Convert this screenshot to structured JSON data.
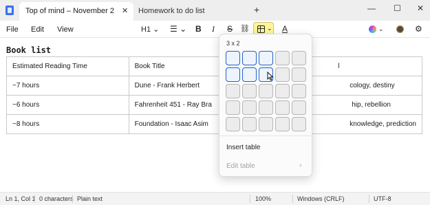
{
  "tabs": {
    "active_title": "Top of mind – November 2",
    "close_glyph": "✕",
    "second_title": "Homework to do list",
    "new_tab_glyph": "+"
  },
  "window": {
    "minimize": "—",
    "maximize": "☐",
    "close": "✕"
  },
  "menu": {
    "file": "File",
    "edit": "Edit",
    "view": "View"
  },
  "toolbar": {
    "heading": "H1 ⌄",
    "list": "☰ ⌄",
    "bold": "B",
    "italic": "I",
    "strike": "S",
    "link": "⛓",
    "table_chevron": "⌄",
    "spellcheck": "A",
    "copilot_chevron": "⌄",
    "settings": "⚙"
  },
  "document": {
    "title": "Book list",
    "table": {
      "headers": [
        "Estimated Reading Time",
        "Book Title",
        "l"
      ],
      "rows": [
        [
          "~7 hours",
          "Dune - Frank Herbert",
          "cology, destiny"
        ],
        [
          "~6 hours",
          "Fahrenheit 451 - Ray Bra",
          "hip, rebellion"
        ],
        [
          "~8 hours",
          "Foundation - Isaac Asim",
          "knowledge, prediction"
        ]
      ]
    }
  },
  "table_popup": {
    "size_label": "3 x 2",
    "grid": {
      "cols": 5,
      "rows": 5,
      "selected_cols": 3,
      "selected_rows": 2
    },
    "insert_label": "Insert table",
    "edit_label": "Edit table",
    "edit_arrow": "›"
  },
  "status": {
    "position": "Ln 1, Col 1",
    "characters": "0 characters",
    "format": "Plain text",
    "zoom": "100%",
    "line_endings": "Windows (CRLF)",
    "encoding": "UTF-8"
  },
  "colors": {
    "table_button_highlight": "#fff59a",
    "selected_cell_border": "#1f5fc4"
  }
}
